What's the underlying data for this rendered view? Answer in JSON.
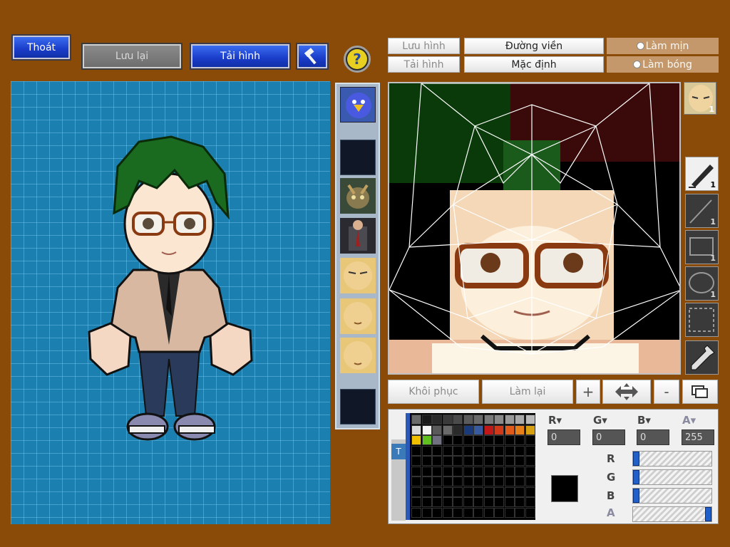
{
  "top_bar": {
    "exit_label": "Thoát",
    "save_label": "Lưu lại",
    "load_label": "Tải hình"
  },
  "editor_toolbar": {
    "save_image_label": "Lưu hình",
    "load_image_label": "Tải hình",
    "outline_label": "Đường viền",
    "default_label": "Mặc định",
    "smooth_label": "Làm mịn",
    "shade_label": "Làm bóng"
  },
  "action_bar": {
    "restore_label": "Khôi phục",
    "redo_label": "Làm lại",
    "zoom_in_symbol": "+",
    "zoom_out_symbol": "-"
  },
  "tools": {
    "pen_size": "1",
    "line_size": "1",
    "rect_size": "1",
    "ellipse_size": "1",
    "face_badge": "1"
  },
  "color_inputs": {
    "r_value": "0",
    "g_value": "0",
    "b_value": "0",
    "a_value": "255"
  },
  "sliders": {
    "r": 0,
    "g": 0,
    "b": 0,
    "a": 1
  },
  "palette_tab_label": "T",
  "current_color": "#000000",
  "palette_colors": [
    "#6a6a6a",
    "#1a1a1a",
    "#2a2a2a",
    "#3a3a3a",
    "#4a4a4a",
    "#5a5a5a",
    "#6a6a6a",
    "#7a7a7a",
    "#8a8a8a",
    "#9a9a9a",
    "#aaaaaa",
    "#bababa",
    "#dadada",
    "#f4f4f4",
    "#5a5a5a",
    "#6a6a6a",
    "#2a2a2a",
    "#1a3a7a",
    "#3a5aa0",
    "#c01818",
    "#d03a1a",
    "#e05a1a",
    "#e8801a",
    "#d8a010",
    "#f0c000",
    "#60c020",
    "#707080"
  ]
}
